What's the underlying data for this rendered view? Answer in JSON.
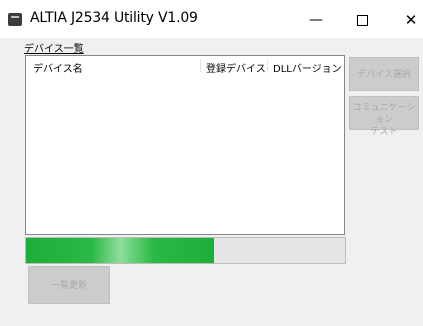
{
  "window": {
    "title": "ALTIA  J2534 Utility V1.09",
    "minimize_glyph": "—",
    "close_glyph": "✕",
    "icon": "app-icon"
  },
  "device_group": {
    "label": "デバイス一覧",
    "columns": [
      "デバイス名",
      "登録デバイス",
      "DLLバージョン"
    ],
    "rows": []
  },
  "progress": {
    "value": 0.59,
    "color": "#2bb844"
  },
  "buttons": {
    "select_device": "デバイス選択",
    "comm_test_line1": "コミュニケーション",
    "comm_test_line2": "テスト",
    "refresh": "一覧更新"
  }
}
